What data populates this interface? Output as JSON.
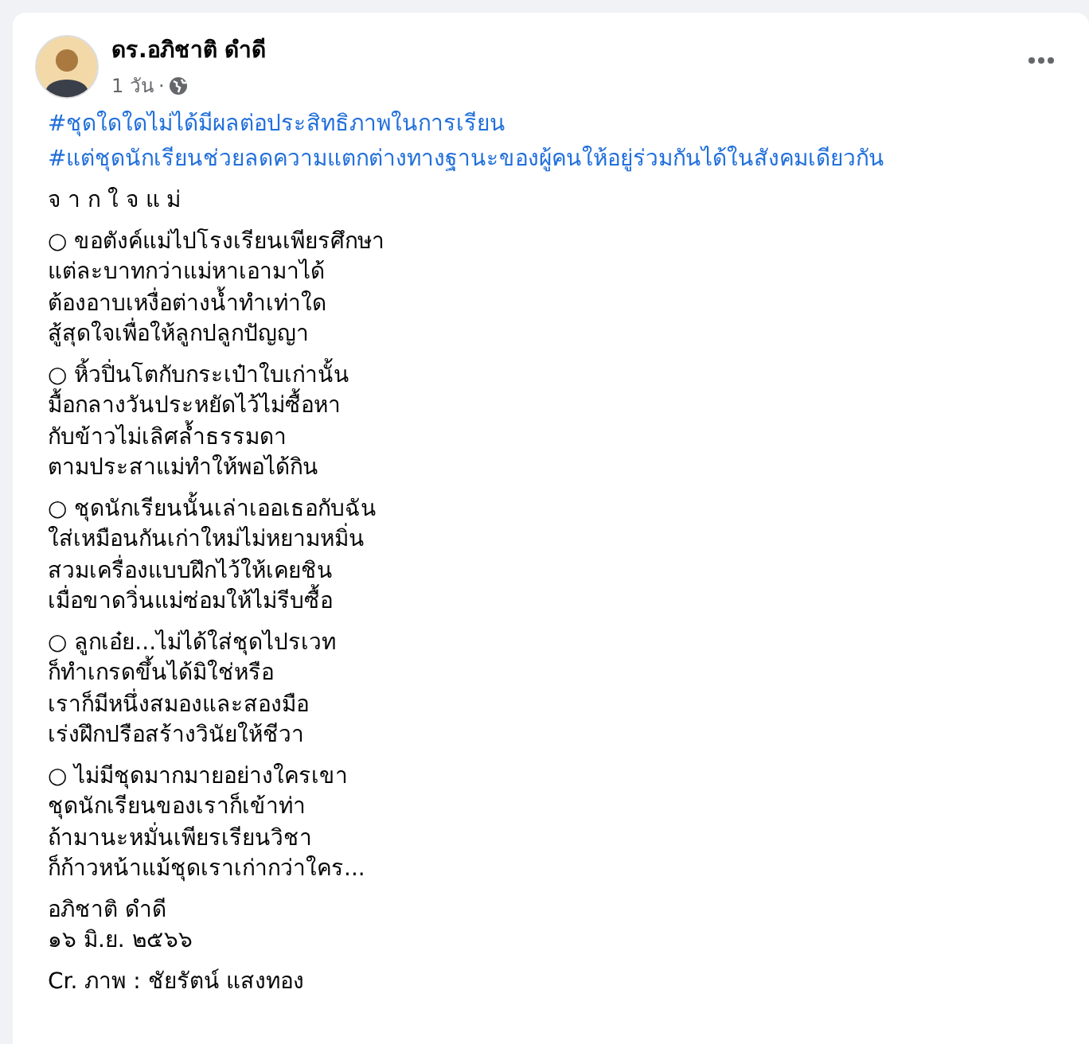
{
  "post": {
    "author": "ดร.อภิชาติ ดำดี",
    "time": "1 วัน",
    "separator": "·"
  },
  "hashtags": [
    "#ชุดใดใดไม่ได้มีผลต่อประสิทธิภาพในการเรียน",
    "#แต่ชุดนักเรียนช่วยลดความแตกต่างทางฐานะของผู้คนให้อยู่ร่วมกันได้ในสังคมเดียวกัน"
  ],
  "poem_title": "จ า ก ใ จ แ ม่",
  "stanzas": [
    [
      "○ ขอตังค์แม่ไปโรงเรียนเพียรศึกษา",
      "แต่ละบาทกว่าแม่หาเอามาได้",
      "ต้องอาบเหงื่อต่างน้ำทำเท่าใด",
      "สู้สุดใจเพื่อให้ลูกปลูกปัญญา"
    ],
    [
      "○ หิ้วปิ่นโตกับกระเป๋าใบเก่านั้น",
      "มื้อกลางวันประหยัดไว้ไม่ซื้อหา",
      "กับข้าวไม่เลิศล้ำธรรมดา",
      "ตามประสาแม่ทำให้พอได้กิน"
    ],
    [
      "○ ชุดนักเรียนนั้นเล่าเออเธอกับฉัน",
      "ใส่เหมือนกันเก่าใหม่ไม่หยามหมิ่น",
      "สวมเครื่องแบบฝึกไว้ให้เคยชิน",
      "เมื่อขาดวิ่นแม่ซ่อมให้ไม่รีบซื้อ"
    ],
    [
      "○ ลูกเอ๋ย...ไม่ได้ใส่ชุดไปรเวท",
      "ก็ทำเกรดขึ้นได้มิใช่หรือ",
      "เราก็มีหนึ่งสมองและสองมือ",
      "เร่งฝึกปรือสร้างวินัยให้ชีวา"
    ],
    [
      "○ ไม่มีชุดมากมายอย่างใครเขา",
      "ชุดนักเรียนของเราก็เข้าท่า",
      "ถ้ามานะหมั่นเพียรเรียนวิชา",
      "ก็ก้าวหน้าแม้ชุดเราเก่ากว่าใคร..."
    ],
    [
      "อภิชาติ ดำดี",
      "๑๖ มิ.ย. ๒๕๖๖"
    ],
    [
      "Cr. ภาพ : ชัยรัตน์ แสงทอง"
    ]
  ]
}
